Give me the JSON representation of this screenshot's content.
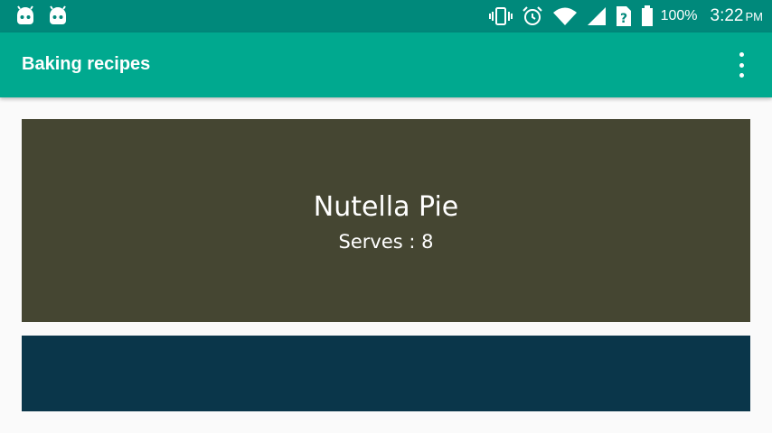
{
  "status_bar": {
    "left_icons": [
      "android-icon",
      "android-icon"
    ],
    "right_icons": [
      "vibrate-icon",
      "alarm-icon",
      "wifi-icon",
      "cellular-signal-icon",
      "sim-unknown-icon",
      "battery-icon"
    ],
    "battery_percent": "100%",
    "time": "3:22",
    "ampm": "PM"
  },
  "app_bar": {
    "title": "Baking recipes",
    "overflow_icon": "more-vert-icon"
  },
  "recipes": [
    {
      "name": "Nutella Pie",
      "serves_label": "Serves : 8",
      "color": "#454632"
    },
    {
      "name": "",
      "serves_label": "",
      "color": "#0a364a"
    }
  ],
  "colors": {
    "status_bar": "#00897b",
    "app_bar": "#00a98f",
    "background": "#fafafa"
  }
}
